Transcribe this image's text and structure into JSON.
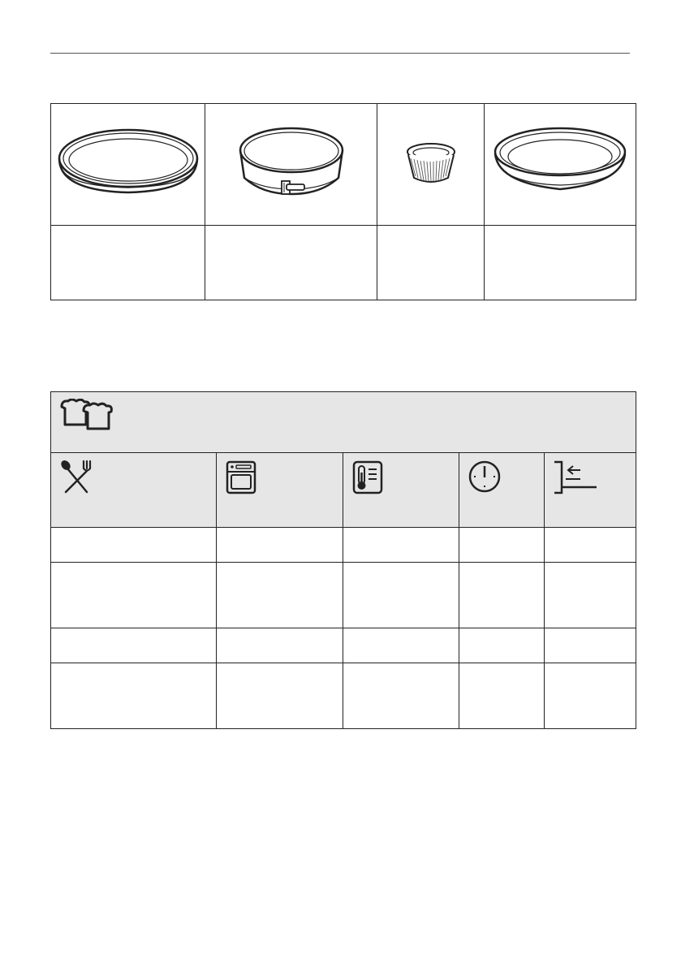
{
  "page": {
    "rule_color": "#555555",
    "header_fill_color": "#e6e6e6"
  },
  "cookware": {
    "images": [
      {
        "icon": "flat-baking-tin-icon"
      },
      {
        "icon": "springform-tin-icon"
      },
      {
        "icon": "ramekin-icon"
      },
      {
        "icon": "deep-pie-dish-icon"
      }
    ],
    "labels": [
      "",
      "",
      "",
      ""
    ]
  },
  "program_table": {
    "header_icon": "muffins-icon",
    "column_icons": [
      "cutlery-icon",
      "oven-function-icon",
      "temperature-icon",
      "clock-icon",
      "shelf-position-icon"
    ],
    "rows": [
      [
        "",
        "",
        "",
        "",
        ""
      ],
      [
        "",
        "",
        "",
        "",
        ""
      ],
      [
        "",
        "",
        "",
        "",
        ""
      ],
      [
        "",
        "",
        "",
        "",
        ""
      ]
    ]
  }
}
